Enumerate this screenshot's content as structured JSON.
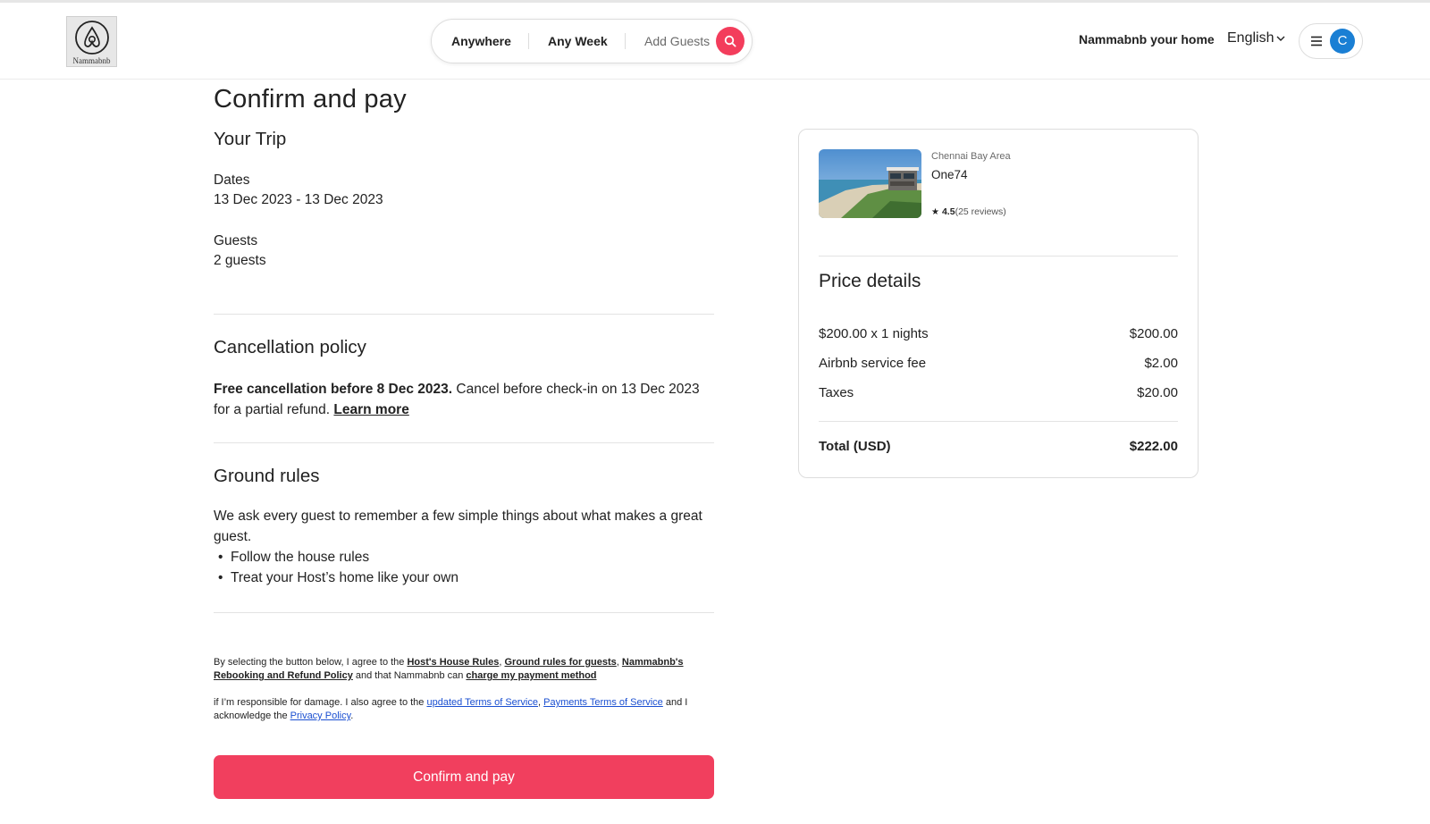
{
  "header": {
    "logo_text": "Nammabnb",
    "search": {
      "anywhere": "Anywhere",
      "any_week": "Any Week",
      "add_guests": "Add Guests"
    },
    "host_link": "Nammabnb your home",
    "language": "English",
    "avatar_initial": "C"
  },
  "page": {
    "title": "Confirm and pay"
  },
  "trip": {
    "heading": "Your Trip",
    "dates_label": "Dates",
    "dates_value": "13 Dec 2023 - 13 Dec 2023",
    "guests_label": "Guests",
    "guests_value": "2 guests"
  },
  "cancellation": {
    "heading": "Cancellation policy",
    "bold": "Free cancellation before 8 Dec 2023.",
    "text": " Cancel before check-in on 13 Dec 2023 for a partial refund. ",
    "learn_more": "Learn more"
  },
  "ground_rules": {
    "heading": "Ground rules",
    "intro": "We ask every guest to remember a few simple things about what makes a great guest.",
    "items": [
      "Follow the house rules",
      "Treat your Host’s home like your own"
    ]
  },
  "legal": {
    "p1_prefix": "By selecting the button below, I agree to the ",
    "house_rules": "Host's House Rules",
    "comma1": ", ",
    "ground_rules": "Ground rules for guests",
    "comma2": ", ",
    "refund_policy": "Nammabnb's Rebooking and Refund Policy",
    "p1_mid": " and that Nammabnb can ",
    "charge": "charge my payment method",
    "p2_prefix": "if I’m responsible for damage. I also agree to the ",
    "tos": "updated Terms of Service",
    "comma3": ", ",
    "payments_tos": "Payments Terms of Service",
    "p2_mid": " and I acknowledge the ",
    "privacy": "Privacy Policy",
    "period": "."
  },
  "confirm_button": "Confirm and pay",
  "listing": {
    "area": "Chennai Bay Area",
    "name": "One74",
    "rating": "4.5",
    "reviews": "(25 reviews)"
  },
  "price_details": {
    "heading": "Price details",
    "rows": [
      {
        "label": "$200.00 x 1 nights",
        "amount": "$200.00"
      },
      {
        "label": "Airbnb service fee",
        "amount": "$2.00"
      },
      {
        "label": "Taxes",
        "amount": "$20.00"
      }
    ],
    "total_label": "Total (USD)",
    "total_amount": "$222.00"
  },
  "colors": {
    "brand": "#f13f5e",
    "avatar": "#1a7fd4",
    "link_blue": "#1a4fd1"
  },
  "icons": [
    "airbnb-logo-icon",
    "search-icon",
    "chevron-down-icon",
    "menu-icon",
    "star-icon"
  ]
}
